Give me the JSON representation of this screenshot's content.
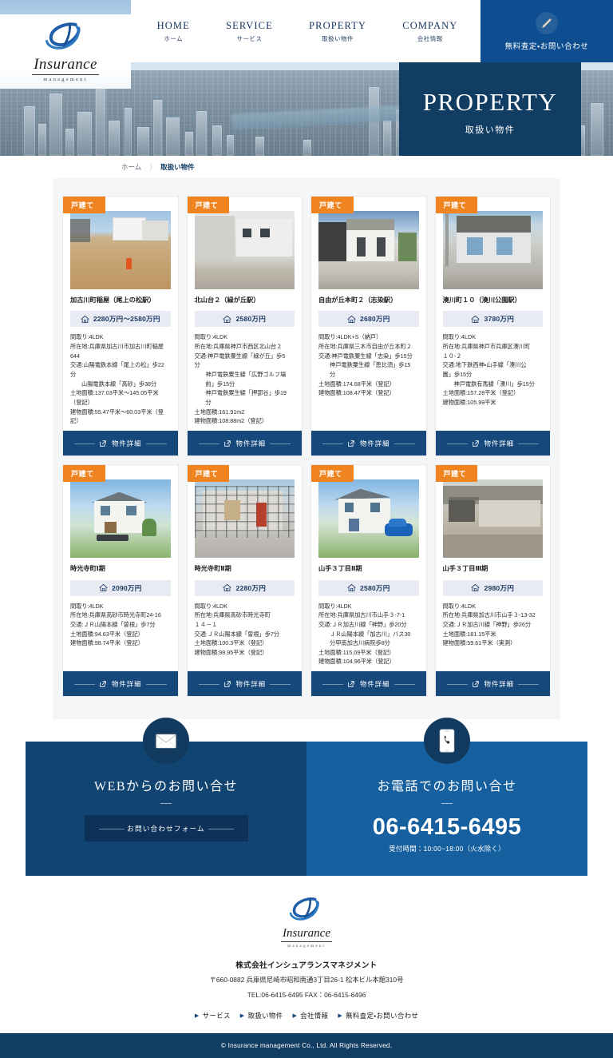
{
  "brand": {
    "name": "Insurance",
    "tagline": "management"
  },
  "nav": {
    "items": [
      {
        "en": "HOME",
        "jp": "ホーム"
      },
      {
        "en": "SERVICE",
        "jp": "サービス"
      },
      {
        "en": "PROPERTY",
        "jp": "取扱い物件"
      },
      {
        "en": "COMPANY",
        "jp": "会社情報"
      }
    ],
    "cta": {
      "label": "無料査定・お問い合わせ",
      "icon": "pen-icon"
    }
  },
  "hero": {
    "title_en": "PROPERTY",
    "title_jp": "取扱い物件"
  },
  "breadcrumb": {
    "home": "ホーム",
    "current": "取扱い物件"
  },
  "colors": {
    "navy": "#123d63",
    "navy_dark": "#0d3158",
    "blue": "#16487c",
    "cta_blue": "#0e4d8f",
    "tel_blue": "#17609f",
    "orange": "#f08421",
    "badge_bg": "#e8ebf3",
    "panel_bg": "#f5f6f8"
  },
  "cards": [
    {
      "tag": "戸建て",
      "title": "加古川町稲屋（尾上の松駅）",
      "price": "2280万円～2580万円",
      "specs": [
        {
          "text": "間取り:4LDK",
          "indent": false
        },
        {
          "text": "所在地:兵庫県加古川市加古川町稲屋\n644",
          "indent": false
        },
        {
          "text": "交通:山陽電鉄本線「尾上の松」歩22\n分",
          "indent": false
        },
        {
          "text": "山陽電鉄本線「高砂」歩38分",
          "indent": true
        },
        {
          "text": "土地面積:137.03平米～145.05平米\n（登記）",
          "indent": false
        },
        {
          "text": "建物面積:55.47平米～60.03平米（登\n記）",
          "indent": false
        }
      ],
      "button": "物件詳細",
      "photo": "land-lot-photo"
    },
    {
      "tag": "戸建て",
      "title": "北山台２（緑が丘駅）",
      "price": "2580万円",
      "specs": [
        {
          "text": "間取り:4LDK",
          "indent": false
        },
        {
          "text": "所在地:兵庫県神戸市西区北山台２",
          "indent": false
        },
        {
          "text": "交通:神戸電鉄粟生線「緑が丘」歩5\n分",
          "indent": false
        },
        {
          "text": "神戸電鉄粟生線「広野ゴルフ場\n前」歩15分",
          "indent": true
        },
        {
          "text": "神戸電鉄粟生線「押部谷」歩19\n分",
          "indent": true
        },
        {
          "text": "土地面積:161.91m2",
          "indent": false
        },
        {
          "text": "建物面積:108.88m2（登記）",
          "indent": false
        }
      ],
      "button": "物件詳細",
      "photo": "white-house-photo"
    },
    {
      "tag": "戸建て",
      "title": "自由が丘本町２（志染駅）",
      "price": "2680万円",
      "specs": [
        {
          "text": "間取り:4LDK+S（納戸）",
          "indent": false
        },
        {
          "text": "所在地:兵庫県三木市自由が丘本町２",
          "indent": false
        },
        {
          "text": "交通:神戸電鉄粟生線「志染」歩15分",
          "indent": false
        },
        {
          "text": "神戸電鉄粟生線「恵比須」歩15\n分",
          "indent": true
        },
        {
          "text": "土地面積:174.68平米（登記）",
          "indent": false
        },
        {
          "text": "建物面積:108.47平米（登記）",
          "indent": false
        }
      ],
      "button": "物件詳細",
      "photo": "modern-house-photo"
    },
    {
      "tag": "戸建て",
      "title": "湊川町１０（湊川公園駅）",
      "price": "3780万円",
      "specs": [
        {
          "text": "間取り:4LDK",
          "indent": false
        },
        {
          "text": "所在地:兵庫県神戸市兵庫区湊川町\n１０-２",
          "indent": false
        },
        {
          "text": "交通:地下鉄西神・山手線「湊川公\n園」歩15分",
          "indent": false
        },
        {
          "text": "神戸電鉄有馬線「湊川」歩15分",
          "indent": true
        },
        {
          "text": "土地面積:157.28平米（登記）",
          "indent": false
        },
        {
          "text": "建物面積:105.99平米",
          "indent": false
        }
      ],
      "button": "物件詳細",
      "photo": "townhouse-photo"
    },
    {
      "tag": "戸建て",
      "title": "時光寺町Ⅰ期",
      "price": "2090万円",
      "specs": [
        {
          "text": "間取り:4LDK",
          "indent": false
        },
        {
          "text": "所在地:兵庫県高砂市時光寺町24-16",
          "indent": false
        },
        {
          "text": "交通:ＪＲ山陽本線「曽根」歩7分",
          "indent": false
        },
        {
          "text": "土地面積:94.63平米（登記）",
          "indent": false
        },
        {
          "text": "建物面積:98.74平米（登記）",
          "indent": false
        }
      ],
      "button": "物件詳細",
      "photo": "render-house-photo"
    },
    {
      "tag": "戸建て",
      "title": "時光寺町Ⅱ期",
      "price": "2280万円",
      "specs": [
        {
          "text": "間取り:4LDK",
          "indent": false
        },
        {
          "text": "所在地:兵庫県高砂市時光寺町\n１４－１",
          "indent": false
        },
        {
          "text": "交通:ＪＲ山陽本線「曽根」歩7分",
          "indent": false
        },
        {
          "text": "土地面積:100.3平米（登記）",
          "indent": false
        },
        {
          "text": "建物面積:98.95平米（登記）",
          "indent": false
        }
      ],
      "button": "物件詳細",
      "photo": "construction-photo"
    },
    {
      "tag": "戸建て",
      "title": "山手３丁目Ⅱ期",
      "price": "2580万円",
      "specs": [
        {
          "text": "間取り:4LDK",
          "indent": false
        },
        {
          "text": "所在地:兵庫県加古川市山手３-7-1",
          "indent": false
        },
        {
          "text": "交通:ＪＲ加古川線「神野」歩20分",
          "indent": false
        },
        {
          "text": "ＪＲ山陽本線「加古川」バス30\n分甲南加古川病院歩8分",
          "indent": true
        },
        {
          "text": "土地面積:115.09平米（登記）",
          "indent": false
        },
        {
          "text": "建物面積:104.96平米（登記）",
          "indent": false
        }
      ],
      "button": "物件詳細",
      "photo": "render-house-car-photo"
    },
    {
      "tag": "戸建て",
      "title": "山手３丁目Ⅲ期",
      "price": "2980万円",
      "specs": [
        {
          "text": "間取り:4LDK",
          "indent": false
        },
        {
          "text": "所在地:兵庫県加古川市山手３-13-32",
          "indent": false
        },
        {
          "text": "交通:ＪＲ加古川線「神野」歩26分",
          "indent": false
        },
        {
          "text": "土地面積:181.15平米",
          "indent": false
        },
        {
          "text": "建物面積:59.61平米（実測）",
          "indent": false
        }
      ],
      "button": "物件詳細",
      "photo": "carport-house-photo"
    }
  ],
  "contact": {
    "web": {
      "heading": "WEBからのお問い合せ",
      "button": "お問い合わせフォーム",
      "icon": "mail-icon"
    },
    "tel": {
      "heading": "お電話でのお問い合せ",
      "number": "06-6415-6495",
      "hours": "受付時間：10:00~18:00（火水除く）",
      "icon": "mobile-phone-icon"
    }
  },
  "footer": {
    "company": "株式会社インシュアランスマネジメント",
    "address_line1": "〒660-0882 兵庫県尼崎市昭和南通3丁目26-1 松本ビル本館310号",
    "address_line2": "TEL:06-6415-6495 FAX：06-6415-6496",
    "links": [
      "サービス",
      "取扱い物件",
      "会社情報",
      "無料査定・お問い合わせ"
    ],
    "copyright": "© Insurance management Co., Ltd. All Rights Reserved."
  }
}
